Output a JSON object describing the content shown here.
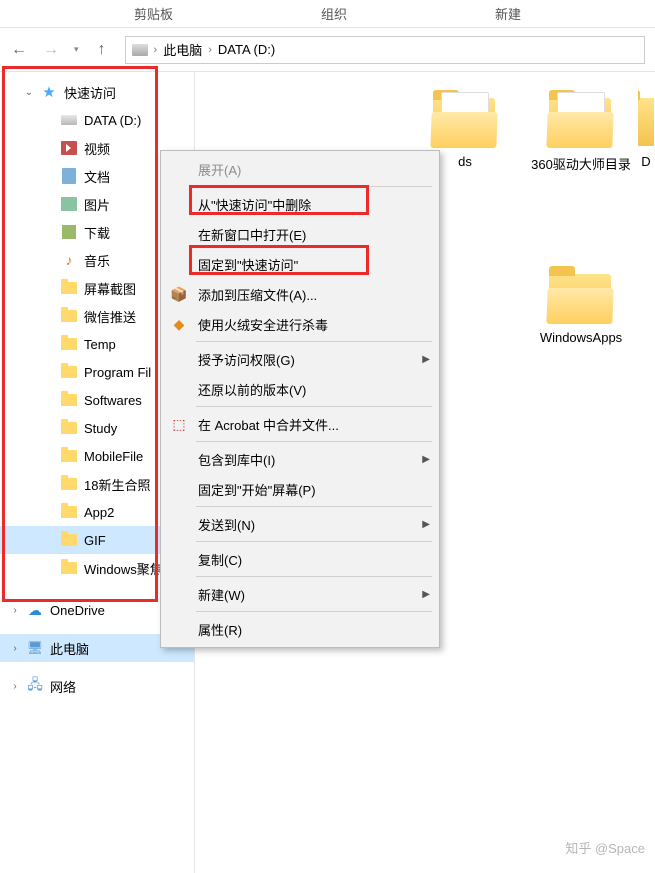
{
  "ribbon": {
    "tab1": "剪贴板",
    "tab2": "组织",
    "tab3": "新建"
  },
  "breadcrumb": {
    "root": "此电脑",
    "current": "DATA (D:)"
  },
  "sidebar": {
    "quick_access": "快速访问",
    "items": [
      {
        "label": "DATA (D:)",
        "icon": "drive"
      },
      {
        "label": "视频",
        "icon": "video"
      },
      {
        "label": "文档",
        "icon": "doc"
      },
      {
        "label": "图片",
        "icon": "pic"
      },
      {
        "label": "下载",
        "icon": "dl"
      },
      {
        "label": "音乐",
        "icon": "music"
      },
      {
        "label": "屏幕截图",
        "icon": "folder"
      },
      {
        "label": "微信推送",
        "icon": "folder"
      },
      {
        "label": "Temp",
        "icon": "folder"
      },
      {
        "label": "Program Fil",
        "icon": "folder"
      },
      {
        "label": "Softwares",
        "icon": "folder"
      },
      {
        "label": "Study",
        "icon": "folder"
      },
      {
        "label": "MobileFile",
        "icon": "folder"
      },
      {
        "label": "18新生合照",
        "icon": "folder"
      },
      {
        "label": "App2",
        "icon": "folder"
      },
      {
        "label": "GIF",
        "icon": "folder"
      },
      {
        "label": "Windows聚焦",
        "icon": "folder"
      }
    ],
    "onedrive": "OneDrive",
    "this_pc": "此电脑",
    "network": "网络"
  },
  "context_menu": {
    "expand": "展开(A)",
    "remove_qa": "从\"快速访问\"中删除",
    "new_window": "在新窗口中打开(E)",
    "pin_qa": "固定到\"快速访问\"",
    "add_archive": "添加到压缩文件(A)...",
    "huorong": "使用火绒安全进行杀毒",
    "grant_access": "授予访问权限(G)",
    "restore_prev": "还原以前的版本(V)",
    "acrobat": "在 Acrobat 中合并文件...",
    "include_lib": "包含到库中(I)",
    "pin_start": "固定到\"开始\"屏幕(P)",
    "send_to": "发送到(N)",
    "copy": "复制(C)",
    "new": "新建(W)",
    "properties": "属性(R)"
  },
  "folders": [
    {
      "label": "ds",
      "partial": true
    },
    {
      "label": "360驱动大师目录"
    },
    {
      "label": "D",
      "partial_right": true
    },
    {
      "label": "WindowsApps"
    }
  ],
  "watermark": "知乎 @Space"
}
